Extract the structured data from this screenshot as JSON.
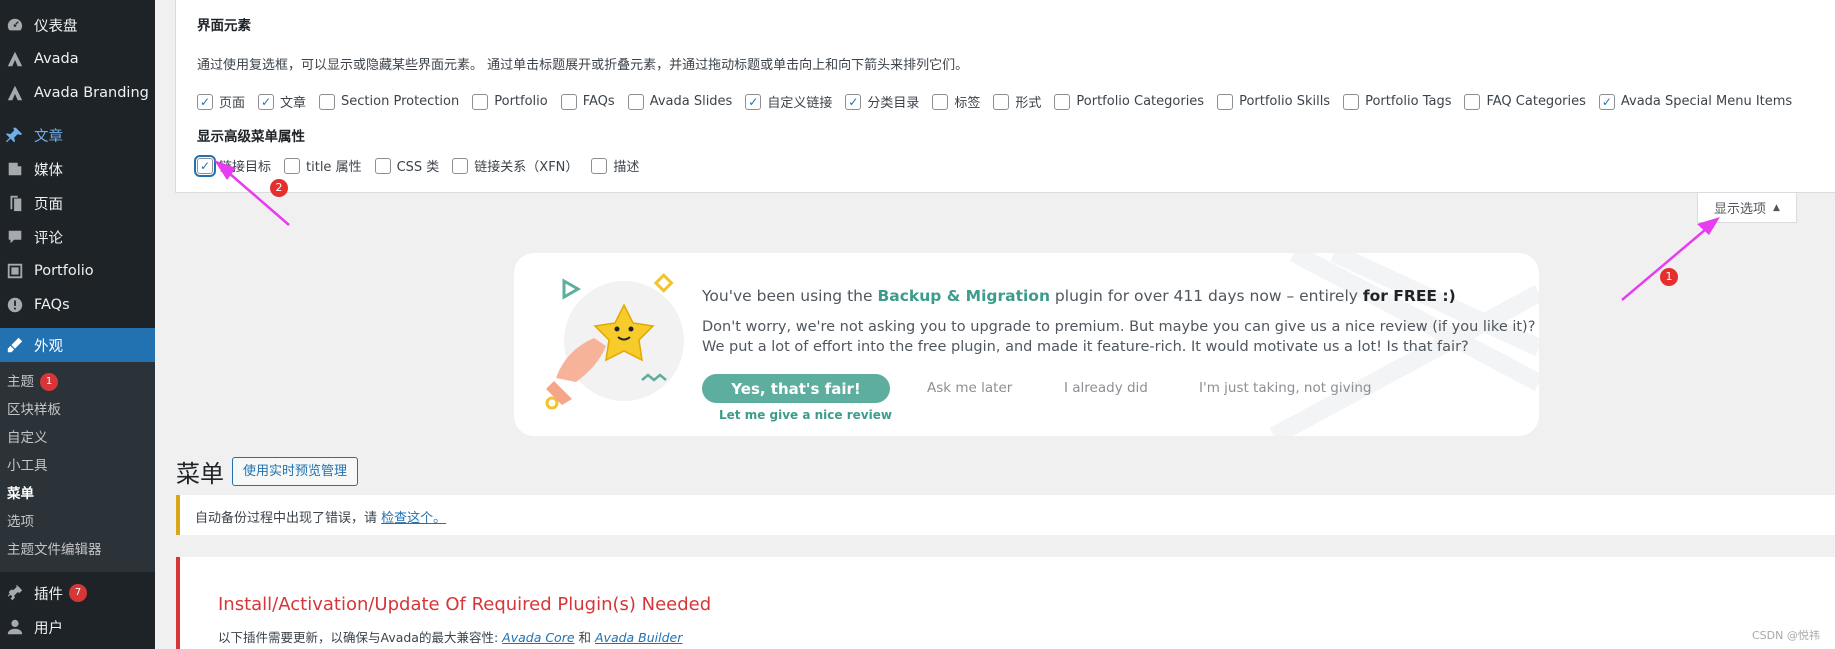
{
  "sidebar": {
    "items": [
      {
        "label": "仪表盘",
        "icon": "dashboard-icon"
      },
      {
        "label": "Avada",
        "icon": "avada-icon"
      },
      {
        "label": "Avada Branding",
        "icon": "avada-branding-icon"
      },
      {
        "label": "文章",
        "icon": "pin-icon"
      },
      {
        "label": "媒体",
        "icon": "media-icon"
      },
      {
        "label": "页面",
        "icon": "page-icon"
      },
      {
        "label": "评论",
        "icon": "comment-icon"
      },
      {
        "label": "Portfolio",
        "icon": "portfolio-icon"
      },
      {
        "label": "FAQs",
        "icon": "faq-icon"
      },
      {
        "label": "外观",
        "icon": "appearance-icon"
      }
    ],
    "submenu": [
      "主题",
      "区块样板",
      "自定义",
      "小工具",
      "菜单",
      "选项",
      "主题文件编辑器"
    ],
    "theme_badge": "1",
    "plugins": {
      "label": "插件",
      "badge": "7"
    },
    "users": {
      "label": "用户"
    }
  },
  "screen_options": {
    "section1_title": "界面元素",
    "description": "通过使用复选框，可以显示或隐藏某些界面元素。 通过单击标题展开或折叠元素，并通过拖动标题或单击向上和向下箭头来排列它们。",
    "elements": [
      {
        "label": "页面",
        "checked": true
      },
      {
        "label": "文章",
        "checked": true
      },
      {
        "label": "Section Protection",
        "checked": false
      },
      {
        "label": "Portfolio",
        "checked": false
      },
      {
        "label": "FAQs",
        "checked": false
      },
      {
        "label": "Avada Slides",
        "checked": false
      },
      {
        "label": "自定义链接",
        "checked": true
      },
      {
        "label": "分类目录",
        "checked": true
      },
      {
        "label": "标签",
        "checked": false
      },
      {
        "label": "形式",
        "checked": false
      },
      {
        "label": "Portfolio Categories",
        "checked": false
      },
      {
        "label": "Portfolio Skills",
        "checked": false
      },
      {
        "label": "Portfolio Tags",
        "checked": false
      },
      {
        "label": "FAQ Categories",
        "checked": false
      },
      {
        "label": "Avada Special Menu Items",
        "checked": true
      }
    ],
    "section2_title": "显示高级菜单属性",
    "advanced": [
      {
        "label": "链接目标",
        "checked": true
      },
      {
        "label": "title 属性",
        "checked": false
      },
      {
        "label": "CSS 类",
        "checked": false
      },
      {
        "label": "链接关系（XFN）",
        "checked": false
      },
      {
        "label": "描述",
        "checked": false
      }
    ],
    "toggle_label": "显示选项"
  },
  "promo": {
    "line1_pre": "You've been using the ",
    "line1_plugin": "Backup & Migration",
    "line1_mid": " plugin for over 411 days now – entirely ",
    "line1_free": "for FREE :)",
    "line2": "Don't worry, we're not asking you to upgrade to premium. But maybe you can give us a nice review (if you like it)?",
    "line3": "We put a lot of effort into the free plugin, and made it feature-rich. It would motivate us a lot! Is that fair?",
    "yes": "Yes, that's fair!",
    "yes_sub": "Let me give a nice review",
    "later": "Ask me later",
    "did": "I already did",
    "not": "I'm just taking, not giving"
  },
  "menus": {
    "title": "菜单",
    "live_button": "使用实时预览管理"
  },
  "backup_notice": {
    "text": "自动备份过程中出现了错误，请 ",
    "link": "检查这个。"
  },
  "plugin_notice": {
    "title": "Install/Activation/Update Of Required Plugin(s) Needed",
    "text_pre": "以下插件需要更新，以确保与Avada的最大兼容性: ",
    "core": "Avada Core",
    "and": " 和 ",
    "builder": "Avada Builder"
  },
  "annotations": [
    "1",
    "2"
  ],
  "watermark": "CSDN @悦祎",
  "colors": {
    "admin_blue": "#2271b1",
    "sidebar_bg": "#1d2327",
    "warning": "#dba617",
    "error": "#d63638",
    "promo_green": "#5dae9f",
    "annotation_arrow": "#e83cf0"
  }
}
